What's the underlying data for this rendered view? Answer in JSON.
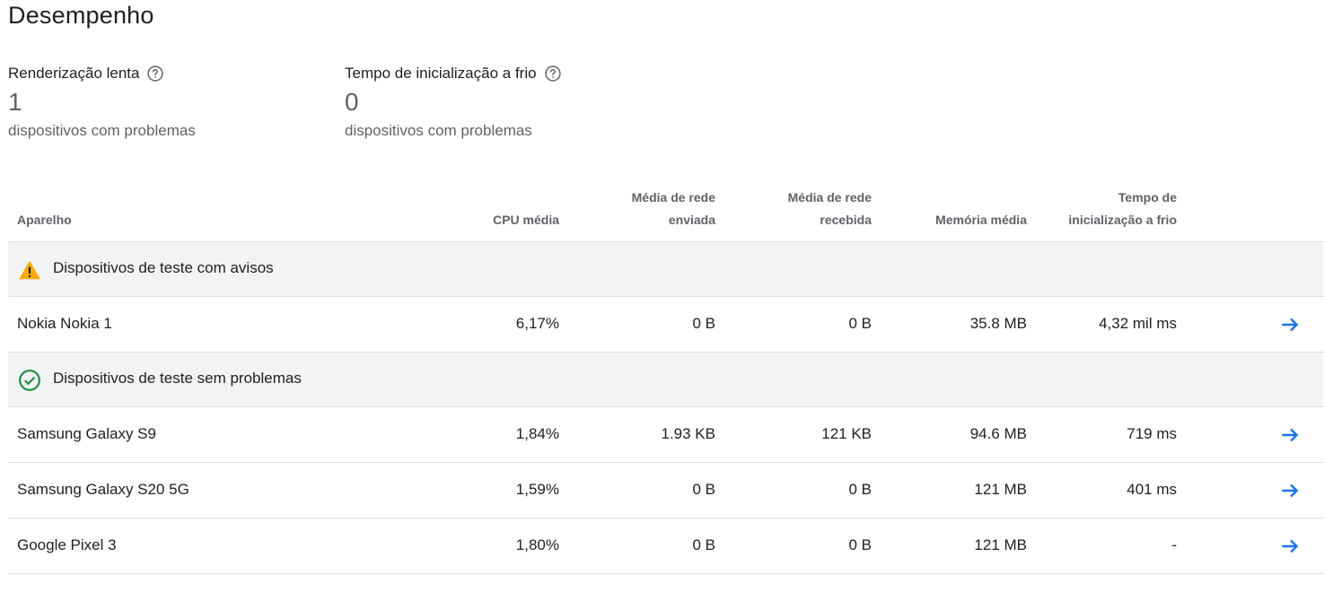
{
  "page": {
    "title": "Desempenho"
  },
  "metrics": [
    {
      "label": "Renderização lenta",
      "value": "1",
      "sub": "dispositivos com problemas"
    },
    {
      "label": "Tempo de inicialização a frio",
      "value": "0",
      "sub": "dispositivos com problemas"
    }
  ],
  "table": {
    "headers": {
      "device": "Aparelho",
      "cpu": "CPU média",
      "net_sent_1": "Média de rede",
      "net_sent_2": "enviada",
      "net_recv_1": "Média de rede",
      "net_recv_2": "recebida",
      "memory": "Memória média",
      "cold_1": "Tempo de",
      "cold_2": "inicialização a frio"
    },
    "groups": [
      {
        "label": "Dispositivos de teste com avisos",
        "icon": "warning-icon",
        "rows": [
          {
            "device": "Nokia Nokia 1",
            "cpu": "6,17%",
            "sent": "0 B",
            "recv": "0 B",
            "memory": "35.8 MB",
            "cold": "4,32 mil ms"
          }
        ]
      },
      {
        "label": "Dispositivos de teste sem problemas",
        "icon": "check-circle-icon",
        "rows": [
          {
            "device": "Samsung Galaxy S9",
            "cpu": "1,84%",
            "sent": "1.93 KB",
            "recv": "121 KB",
            "memory": "94.6 MB",
            "cold": "719 ms"
          },
          {
            "device": "Samsung Galaxy S20 5G",
            "cpu": "1,59%",
            "sent": "0 B",
            "recv": "0 B",
            "memory": "121 MB",
            "cold": "401 ms"
          },
          {
            "device": "Google Pixel 3",
            "cpu": "1,80%",
            "sent": "0 B",
            "recv": "0 B",
            "memory": "121 MB",
            "cold": "-"
          }
        ]
      }
    ]
  },
  "colors": {
    "warning": "#f9ab00",
    "success": "#1e8e3e",
    "accent": "#1a73e8",
    "group_bg": "#f1f3f4"
  }
}
